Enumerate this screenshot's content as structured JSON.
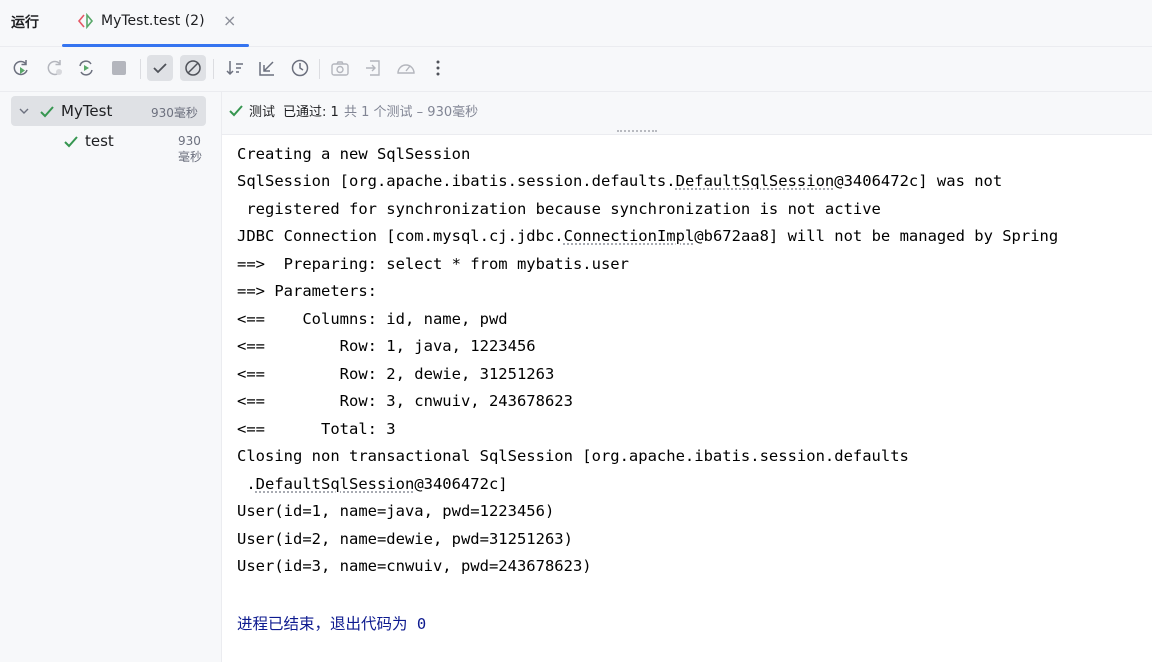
{
  "window": {
    "run_title": "运行",
    "tab_label": "MyTest.test (2)",
    "tab_close": "×"
  },
  "toolbar": {
    "buttons": [
      "rerun-icon",
      "rerun-failed-icon",
      "rerun-automatically-icon",
      "stop-icon",
      "show-passed-icon",
      "show-ignored-icon",
      "sort-icon",
      "collapse-icon",
      "history-icon",
      "screenshot-icon",
      "import-icon",
      "coverage-icon",
      "more-icon"
    ]
  },
  "tree": {
    "root": {
      "label": "MyTest",
      "time": "930毫秒"
    },
    "child": {
      "label": "test",
      "time": "930毫秒"
    }
  },
  "status": {
    "label": "测试",
    "pass": "已通过: 1",
    "summary": "共 1 个测试 – 930毫秒"
  },
  "console": {
    "l1": "Creating a new SqlSession",
    "l2a": "SqlSession [org.apache.ibatis.session.defaults.",
    "l2b": "DefaultSqlSession",
    "l2c": "@3406472c] was not",
    "l3": " registered for synchronization because synchronization is not active",
    "l4a": "JDBC Connection [com.mysql.cj.jdbc.",
    "l4b": "ConnectionImpl",
    "l4c": "@b672aa8] will not be managed by Spring",
    "l5": "==>  Preparing: select * from mybatis.user",
    "l6": "==> Parameters: ",
    "l7": "<==    Columns: id, name, pwd",
    "l8": "<==        Row: 1, java, 1223456",
    "l9": "<==        Row: 2, dewie, 31251263",
    "l10": "<==        Row: 3, cnwuiv, 243678623",
    "l11": "<==      Total: 3",
    "l12": "Closing non transactional SqlSession [org.apache.ibatis.session.defaults",
    "l13a": " .",
    "l13b": "DefaultSqlSession",
    "l13c": "@3406472c]",
    "l14": "User(id=1, name=java, pwd=1223456)",
    "l15": "User(id=2, name=dewie, pwd=31251263)",
    "l16": "User(id=3, name=cnwuiv, pwd=243678623)",
    "exit": "进程已结束，退出代码为 0"
  },
  "colors": {
    "accent": "#3574f0",
    "pass_green": "#369650",
    "exit_text": "#0d1a8f"
  }
}
